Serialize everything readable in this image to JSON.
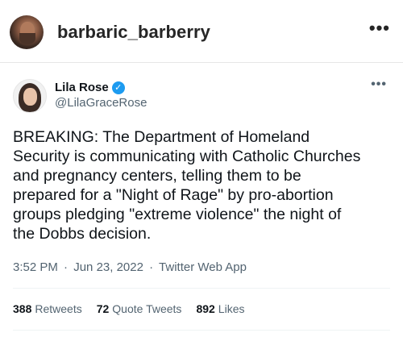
{
  "instagram": {
    "username": "barbaric_barberry",
    "more_icon": "•••"
  },
  "tweet": {
    "display_name": "Lila Rose",
    "verified_icon": "✓",
    "handle": "@LilaGraceRose",
    "more_icon": "•••",
    "text": "BREAKING: The Department of Homeland\nSecurity is communicating with Catholic Churches\nand pregnancy centers, telling them to be\nprepared for a \"Night of Rage\" by pro-abortion\ngroups pledging \"extreme violence\" the night of\nthe Dobbs decision.",
    "time": "3:52 PM",
    "date": "Jun 23, 2022",
    "source": "Twitter Web App",
    "separator": "·",
    "stats": {
      "retweets_count": "388",
      "retweets_label": "Retweets",
      "quotes_count": "72",
      "quotes_label": "Quote Tweets",
      "likes_count": "892",
      "likes_label": "Likes"
    }
  }
}
